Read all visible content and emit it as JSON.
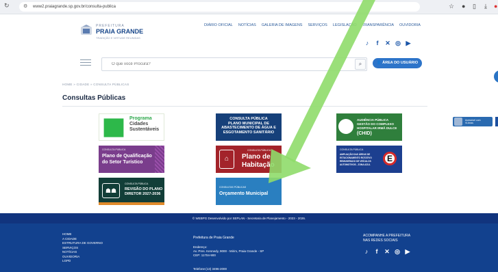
{
  "browser": {
    "url": "www2.praiagrande.sp.gov.br/consulta-publica",
    "icons": [
      "star-icon",
      "profile-icon",
      "extensions-icon",
      "download-icon",
      "menu-icon"
    ]
  },
  "header": {
    "logo_top": "PREFEITURA",
    "logo_name": "PRAIA GRANDE",
    "logo_sub": "TRADIÇÃO E VIRTUDE REUNIDAS",
    "nav": [
      "DIÁRIO OFICIAL",
      "NOTÍCIAS",
      "GALERIA DE IMAGENS",
      "SERVIÇOS",
      "LEGISLAÇÃO",
      "TRANSPARÊNCIA",
      "OUVIDORIA"
    ],
    "social": [
      "tiktok",
      "facebook",
      "x",
      "instagram",
      "youtube"
    ]
  },
  "search": {
    "placeholder": "O que você Procura?"
  },
  "user_area_label": "ÁREA DO USUÁRIO",
  "breadcrumb": "HOME » CIDADE » CONSULTA PÚBLICAS",
  "page_title": "Consultas Públicas",
  "cards": {
    "cidades": {
      "line1": "Programa",
      "line2": "Cidades",
      "line3": "Sustentáveis"
    },
    "abastecimento": {
      "l1": "CONSULTA PÚBLICA",
      "l2": "PLANO MUNICIPAL DE",
      "l3": "ABASTECIMENTO DE ÁGUA E",
      "l4": "ESGOTAMENTO SANITÁRIO"
    },
    "chid": {
      "l1": "AUDIÊNCIA PÚBLICA",
      "l2": "GESTÃO DO COMPLEXO",
      "l3": "HOSPITALAR IRMÃ DULCE",
      "l4": "(CHID)"
    },
    "turistico": {
      "sub": "CONSULTA PÚBLICA",
      "l1": "Plano de Qualificação",
      "l2": "do Setor Turístico"
    },
    "habitacao": {
      "sub": "CONSULTA PÚBLICA",
      "l1": "Plano de",
      "l2": "Habitação"
    },
    "estacionamento": {
      "sub": "CONSULTA PÚBLICA",
      "l1": "AMPLIAÇÃO DAS ÁREAS DE",
      "l2": "ESTACIONAMENTO ROTATIVO",
      "l3": "REMUNERADO DE VEÍCULOS",
      "l4": "AUTOMOTIVOS - ZONA AZUL",
      "badge": "E"
    },
    "plano_diretor": {
      "sub": "CONSULTA PÚBLICA",
      "l1": "REVISÃO DO PLANO",
      "l2": "DIRETOR 2027-2036"
    },
    "orcamento": {
      "sub": "CONSULTAS PÚBLICAS",
      "l1": "Orçamento Municipal"
    }
  },
  "side": {
    "l1": "Acessível com",
    "l2": "VLibras"
  },
  "footer": {
    "copyright": "© WEBPG Desenvolvido por SEPLAN - Secretaria de Planejamento - 2023 - 2026.",
    "links": [
      "HOME",
      "A CIDADE",
      "ESTRUTURA DE GOVERNO",
      "SERVIÇOS",
      "NOTÍCIAS",
      "OUVIDORIA",
      "LGPD"
    ],
    "org": "Prefeitura de Praia Grande",
    "addr_label": "Endereço:",
    "addr": "Av. Pres. Kennedy, 9000 - Mirim, Praia Grande - SP",
    "cep": "CEP: 11704-900",
    "phone": "Telefone:(13) 3496-2000",
    "follow1": "ACOMPANHE A PREFEITURA",
    "follow2": "NAS REDES SOCIAIS"
  },
  "colors": {
    "brand_blue": "#12418e",
    "arrow_green": "#8fdc6a"
  }
}
